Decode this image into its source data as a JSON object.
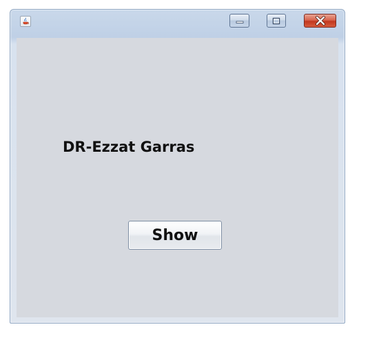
{
  "window": {
    "title": "",
    "icon": "java-coffee-icon",
    "controls": {
      "minimize_icon": "minimize-icon",
      "maximize_icon": "maximize-icon",
      "close_icon": "close-icon"
    },
    "close_color": "#c9442b"
  },
  "content": {
    "label_text": "DR-Ezzat Garras",
    "button_label": "Show",
    "background": "#d6d9df"
  }
}
